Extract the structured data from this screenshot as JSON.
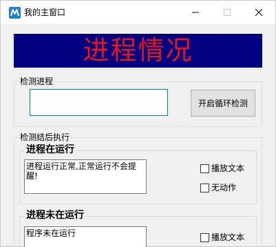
{
  "window": {
    "title": "我的主窗口",
    "controls": {
      "minimize": "minimize-icon",
      "maximize": "maximize-icon",
      "close": "close-icon"
    }
  },
  "banner": {
    "text": "进程情况",
    "text_color": "#e8151b",
    "background": "#000080"
  },
  "detect": {
    "group_label": "检测进程",
    "input_value": "",
    "button_label": "开启循环检测"
  },
  "after": {
    "group_label": "检测结后执行",
    "running": {
      "title": "进程在运行",
      "message": "进程运行正常,正常运行不会提醒!",
      "option_play": "播放文本",
      "option_none": "无动作"
    },
    "not_running": {
      "title": "进程未在运行",
      "message": "程序未在运行",
      "option_play": "播放文本"
    }
  }
}
